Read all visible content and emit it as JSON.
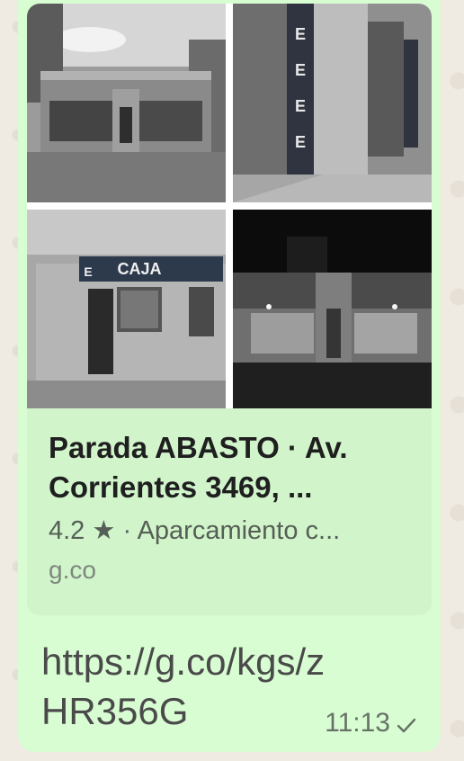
{
  "message": {
    "preview": {
      "title": "Parada ABASTO · Av. Corrientes 3469, ...",
      "rating": "4.2",
      "star": "★",
      "category": "· Aparcamiento c...",
      "domain": "g.co",
      "sign_text": "CAJA",
      "sign_icon_letter": "E",
      "street_number": "3469"
    },
    "link_text": "https://g.co/kgs/zHR356G",
    "time": "11:13",
    "status_icon": "single-check-icon"
  },
  "colors": {
    "bubble": "#d9fdd3",
    "preview_bg": "#d1f4cb",
    "wallpaper": "#efeae2"
  }
}
